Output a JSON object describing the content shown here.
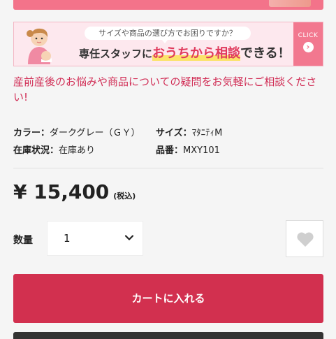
{
  "banner": {
    "bubble_text": "サイズや商品の選び方でお困りですか？",
    "main_lead": "専任スタッフに",
    "main_highlight": "おうちから相談",
    "main_tail": "できる！",
    "click_label": "CLICK"
  },
  "notice": "産前産後のお悩みや商品についての疑問をお気軽にご相談ください!",
  "specs": {
    "color_label": "カラー：",
    "color_value": "ダークグレー（ＧＹ）",
    "size_label": "サイズ：",
    "size_value": "ﾏﾀﾆﾃｨM",
    "stock_label": "在庫状況：",
    "stock_value": "在庫あり",
    "item_no_label": "品番：",
    "item_no_value": "MXY101"
  },
  "price": {
    "amount": "¥ 15,400",
    "tax_note": "(税込)"
  },
  "quantity": {
    "label": "数量",
    "selected": "1"
  },
  "cart_button": "カートに入れる",
  "colors": {
    "accent": "#d2304f",
    "banner_bg": "#fde8ee",
    "click_bg": "#f2788f",
    "notice_text": "#d12e56"
  }
}
